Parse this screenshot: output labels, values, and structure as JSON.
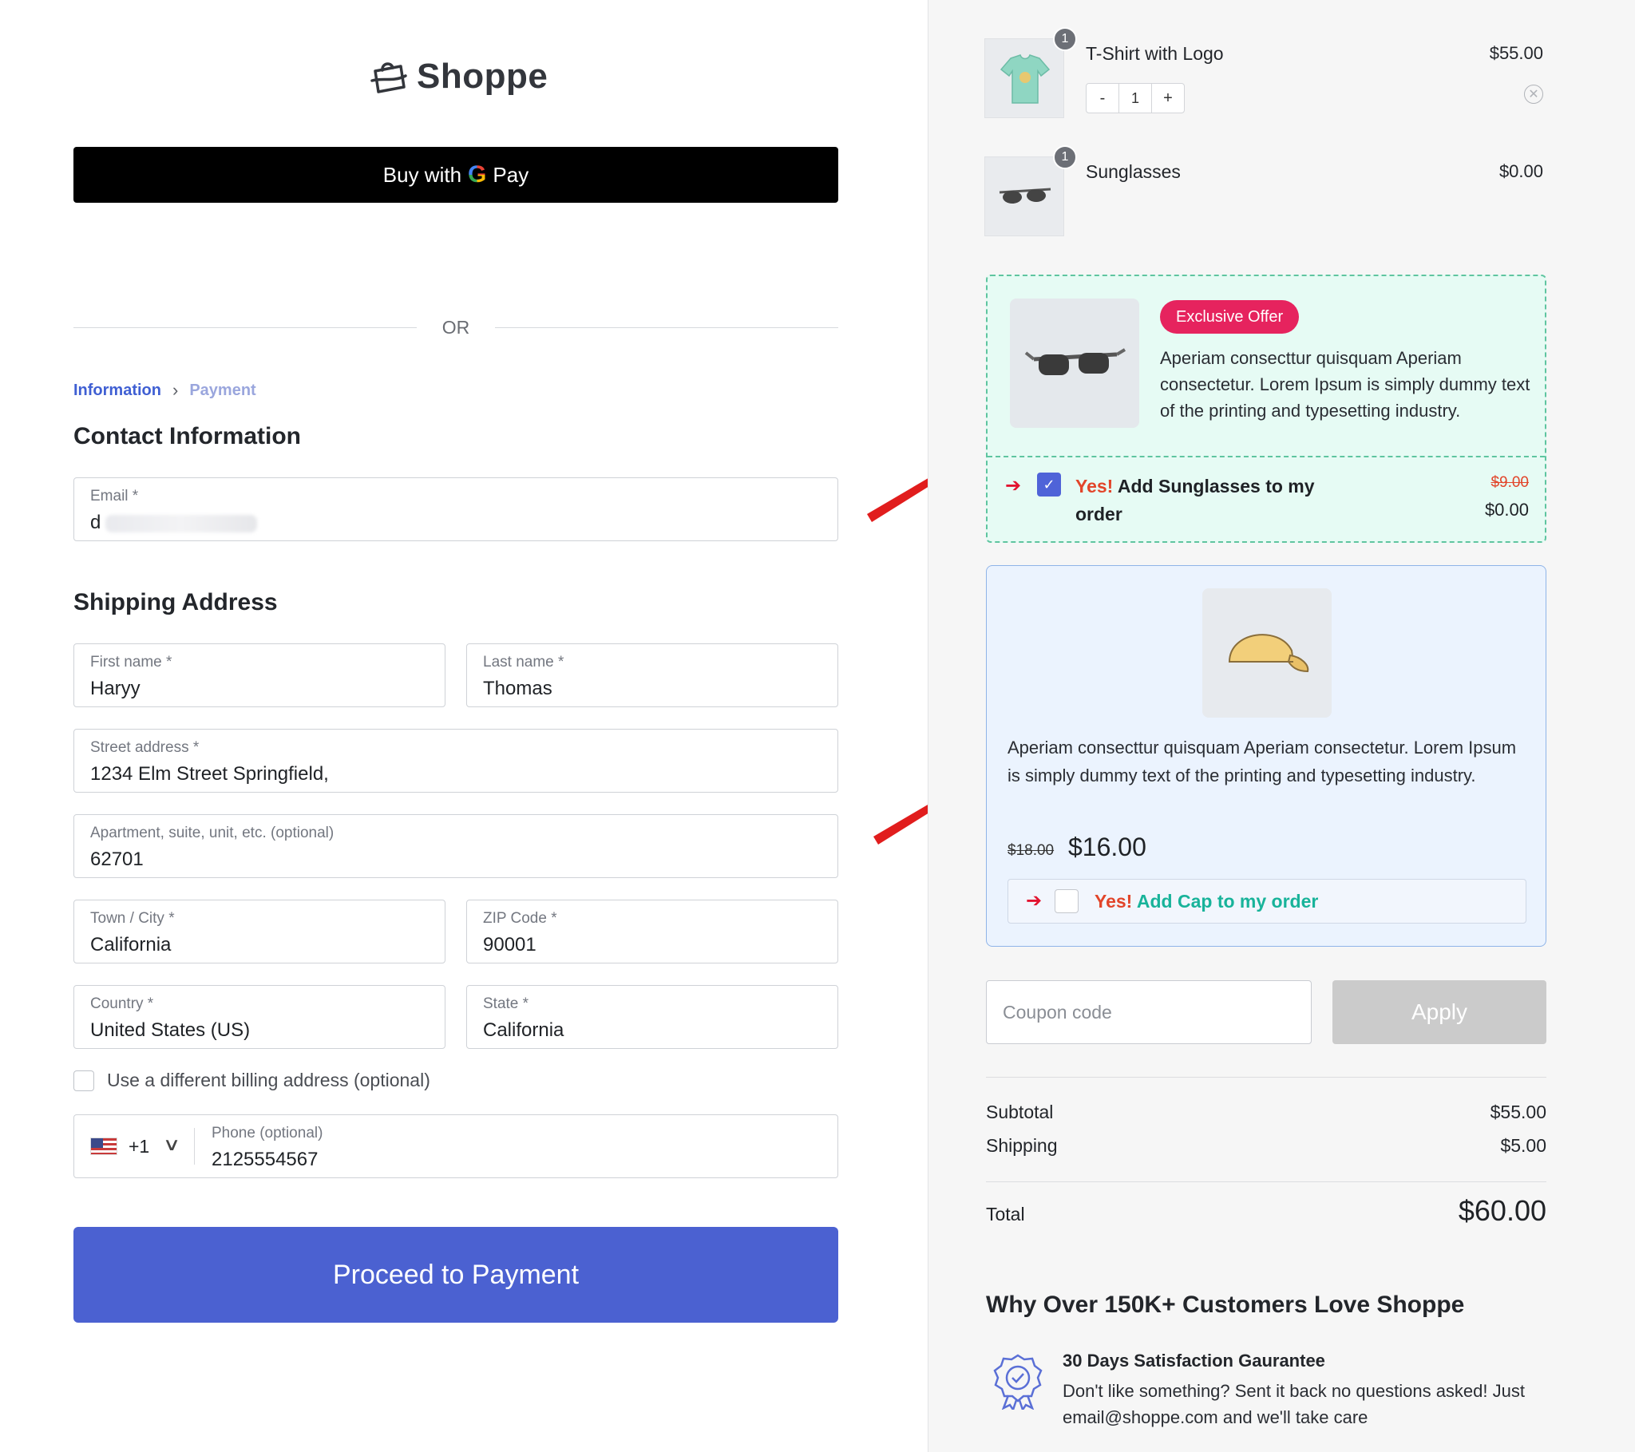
{
  "brand": {
    "name": "Shoppe"
  },
  "express": {
    "buy_with": "Buy with",
    "g": "G",
    "pay": "Pay"
  },
  "divider": {
    "or": "OR"
  },
  "breadcrumb": {
    "step1": "Information",
    "step2": "Payment"
  },
  "contact": {
    "heading": "Contact Information",
    "email_label": "Email *",
    "email_value": "d"
  },
  "shipping": {
    "heading": "Shipping Address",
    "first_name_label": "First name *",
    "first_name": "Haryy",
    "last_name_label": "Last name *",
    "last_name": "Thomas",
    "street_label": "Street address *",
    "street": "1234 Elm Street Springfield,",
    "apt_label": "Apartment, suite, unit, etc. (optional)",
    "apt": "62701",
    "city_label": "Town / City *",
    "city": "California",
    "zip_label": "ZIP Code *",
    "zip": "90001",
    "country_label": "Country *",
    "country": "United States (US)",
    "state_label": "State *",
    "state": "California",
    "billing_checkbox": "Use a different billing address (optional)",
    "phone_code": "+1",
    "phone_label": "Phone (optional)",
    "phone": "2125554567"
  },
  "proceed_label": "Proceed to Payment",
  "cart": {
    "items": [
      {
        "qty_badge": "1",
        "name": "T-Shirt with Logo",
        "price": "$55.00",
        "qty": "1",
        "minus": "-",
        "plus": "+"
      },
      {
        "qty_badge": "1",
        "name": "Sunglasses",
        "price": "$0.00"
      }
    ]
  },
  "offer_exclusive": {
    "badge": "Exclusive Offer",
    "description": "Aperiam consecttur quisquam Aperiam consectetur. Lorem Ipsum is simply dummy text of the printing and typesetting industry.",
    "yes": "Yes!",
    "cta": "Add Sunglasses to my order",
    "old_price": "$9.00",
    "new_price": "$0.00",
    "checked": true
  },
  "offer_cap": {
    "description": "Aperiam consecttur quisquam Aperiam consectetur. Lorem Ipsum is simply dummy text of the printing and typesetting industry.",
    "old_price": "$18.00",
    "new_price": "$16.00",
    "yes": "Yes!",
    "cta": "Add Cap to my order",
    "checked": false
  },
  "coupon": {
    "placeholder": "Coupon code",
    "apply": "Apply"
  },
  "summary": {
    "subtotal_label": "Subtotal",
    "subtotal": "$55.00",
    "shipping_label": "Shipping",
    "shipping": "$5.00",
    "total_label": "Total",
    "total": "$60.00"
  },
  "trust": {
    "heading": "Why Over 150K+ Customers Love Shoppe",
    "title": "30 Days Satisfaction Gaurantee",
    "text": "Don't like something? Sent it back no questions asked! Just email@shoppe.com and we'll take care"
  },
  "colors": {
    "primary": "#4b61d1",
    "accent_red": "#e2132f",
    "badge_pink": "#e6235e",
    "offer_green_border": "#5fc5a0",
    "offer_blue_border": "#8fb4e8"
  }
}
